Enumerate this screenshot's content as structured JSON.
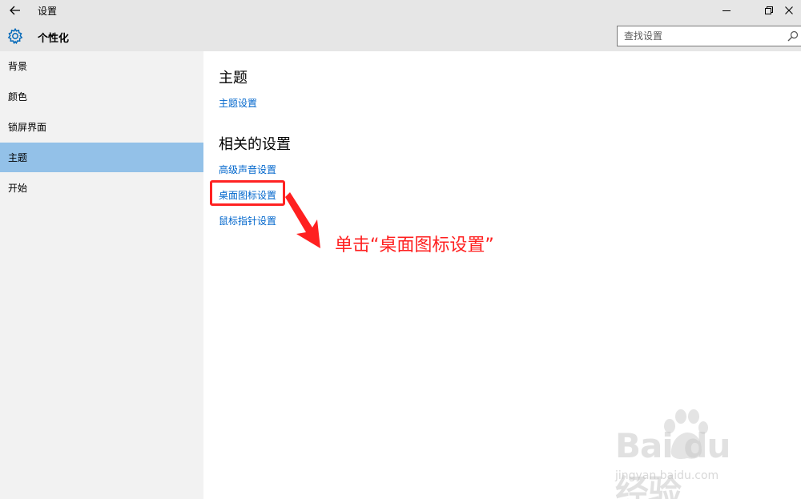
{
  "window": {
    "title": "设置",
    "back_icon": "arrow-left-icon",
    "min_icon": "minimize-icon",
    "max_icon": "restore-icon",
    "close_icon": "close-icon"
  },
  "header": {
    "title": "个性化",
    "icon": "gear-icon"
  },
  "search": {
    "placeholder": "查找设置",
    "value": "",
    "icon": "search-icon"
  },
  "sidebar": {
    "items": [
      {
        "label": "背景",
        "selected": false
      },
      {
        "label": "颜色",
        "selected": false
      },
      {
        "label": "锁屏界面",
        "selected": false
      },
      {
        "label": "主题",
        "selected": true
      },
      {
        "label": "开始",
        "selected": false
      }
    ]
  },
  "main": {
    "sections": [
      {
        "heading": "主题",
        "links": [
          "主题设置"
        ]
      },
      {
        "heading": "相关的设置",
        "links": [
          "高级声音设置",
          "桌面图标设置",
          "鼠标指针设置"
        ]
      }
    ]
  },
  "annotation": {
    "callout": "单击“桌面图标设置”",
    "color": "#ff1f1f"
  },
  "watermark": {
    "logo": "Bai du 经验",
    "url": "jingyan.baidu.com"
  },
  "colors": {
    "accent": "#0066cc",
    "selected_bg": "#93c1e8",
    "chrome_bg": "#e6e6e6",
    "sidebar_bg": "#f2f2f2"
  }
}
